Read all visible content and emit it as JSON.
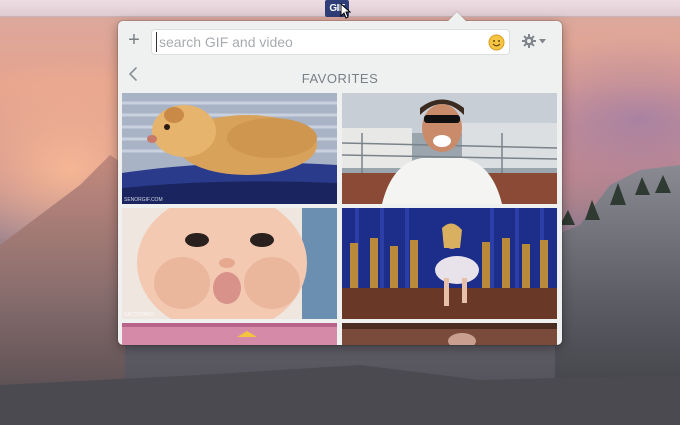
{
  "menubar": {
    "app_icon_text": "GIF",
    "app_icon_color": "#2f3d78"
  },
  "popover": {
    "add_icon": "plus-icon",
    "add_label": "+",
    "search": {
      "placeholder": "search GIF and video",
      "value": ""
    },
    "emoji_icon": "smiley-face-icon",
    "settings_icon": "gear-icon",
    "back_icon": "chevron-left-icon",
    "section_title": "FAVORITES",
    "gifs": [
      {
        "subject": "hamster",
        "watermark": "SENORGIF.COM"
      },
      {
        "subject": "man in sunglasses laughing",
        "watermark": ""
      },
      {
        "subject": "baby puffing cheeks",
        "watermark": "GIF.COTARO"
      },
      {
        "subject": "girl dancing on stage",
        "watermark": ""
      },
      {
        "subject": "partially visible gif",
        "watermark": ""
      },
      {
        "subject": "partially visible gif",
        "watermark": ""
      }
    ]
  },
  "colors": {
    "popover_bg": "#eef1ef",
    "accent": "#2f3d78"
  }
}
